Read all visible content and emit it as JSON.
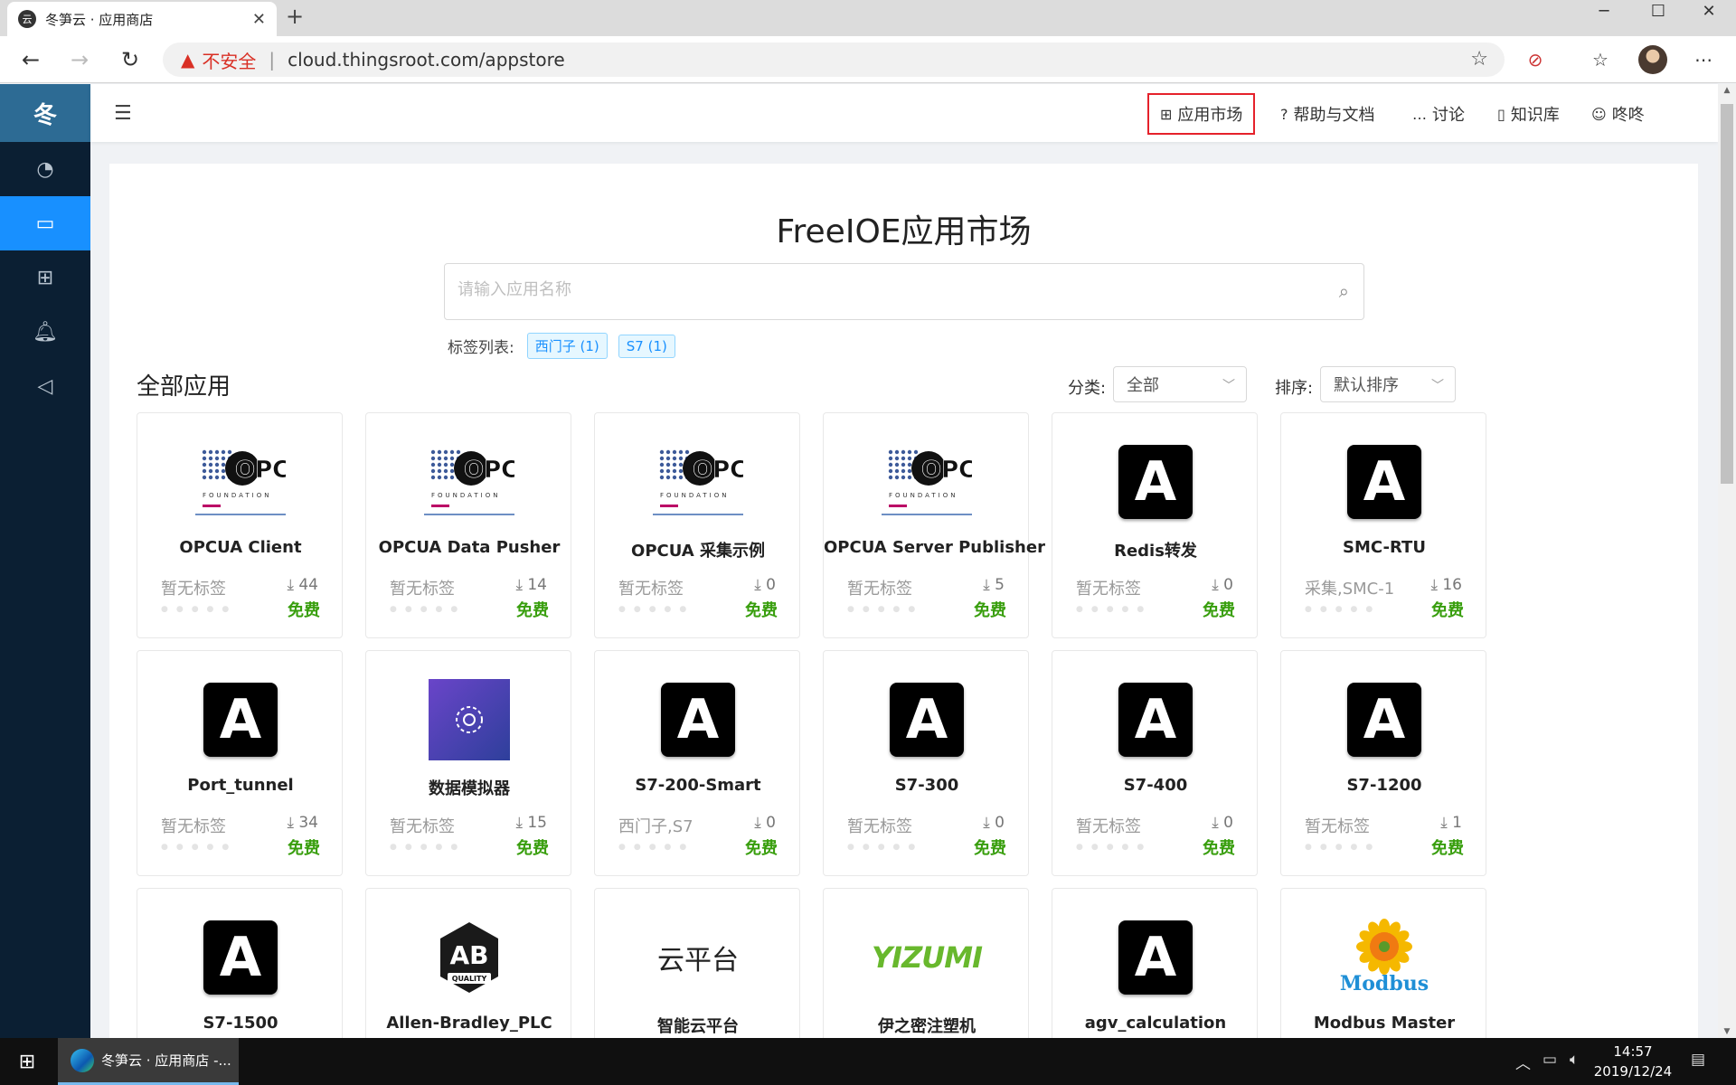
{
  "browser": {
    "tab_title": "冬笋云 · 应用商店",
    "favicon_text": "云",
    "insecure_label": "不安全",
    "url": "cloud.thingsroot.com/appstore",
    "window_controls": [
      "─",
      "☐",
      "✕"
    ]
  },
  "sidebar": {
    "logo": "冬",
    "items": [
      {
        "icon": "dashboard-icon",
        "glyph": "◔"
      },
      {
        "icon": "laptop-icon",
        "glyph": "▭"
      },
      {
        "icon": "apps-grid-icon",
        "glyph": "⊞"
      },
      {
        "icon": "bell-icon",
        "glyph": "🔔︎"
      },
      {
        "icon": "megaphone-icon",
        "glyph": "◁"
      }
    ],
    "active_index": 1
  },
  "header": {
    "nav": [
      {
        "label": "应用市场",
        "icon": "⊞"
      },
      {
        "label": "帮助与文档",
        "icon": "?"
      },
      {
        "label": "讨论",
        "icon": "…"
      },
      {
        "label": "知识库",
        "icon": "▯"
      },
      {
        "label": "咚咚",
        "icon": "☺"
      }
    ]
  },
  "market": {
    "title": "FreeIOE应用市场",
    "search_placeholder": "请输入应用名称",
    "tag_label": "标签列表:",
    "tags": [
      "西门子 (1)",
      "S7 (1)"
    ],
    "section_title": "全部应用",
    "category_label": "分类:",
    "category_value": "全部",
    "sort_label": "排序:",
    "sort_value": "默认排序"
  },
  "apps": [
    {
      "name": "OPCUA Client",
      "logo": "opc",
      "tags": "暂无标签",
      "downloads": "44",
      "price": "免费"
    },
    {
      "name": "OPCUA Data Pusher",
      "logo": "opc",
      "tags": "暂无标签",
      "downloads": "14",
      "price": "免费"
    },
    {
      "name": "OPCUA 采集示例",
      "logo": "opc",
      "tags": "暂无标签",
      "downloads": "0",
      "price": "免费"
    },
    {
      "name": "OPCUA Server Publisher",
      "logo": "opc",
      "tags": "暂无标签",
      "downloads": "5",
      "price": "免费"
    },
    {
      "name": "Redis转发",
      "logo": "A",
      "tags": "暂无标签",
      "downloads": "0",
      "price": "免费"
    },
    {
      "name": "SMC-RTU",
      "logo": "A",
      "tags": "采集,SMC-1",
      "downloads": "16",
      "price": "免费"
    },
    {
      "name": "Port_tunnel",
      "logo": "A",
      "tags": "暂无标签",
      "downloads": "34",
      "price": "免费"
    },
    {
      "name": "数据模拟器",
      "logo": "sim",
      "tags": "暂无标签",
      "downloads": "15",
      "price": "免费"
    },
    {
      "name": "S7-200-Smart",
      "logo": "A",
      "tags": "西门子,S7",
      "downloads": "0",
      "price": "免费"
    },
    {
      "name": "S7-300",
      "logo": "A",
      "tags": "暂无标签",
      "downloads": "0",
      "price": "免费"
    },
    {
      "name": "S7-400",
      "logo": "A",
      "tags": "暂无标签",
      "downloads": "0",
      "price": "免费"
    },
    {
      "name": "S7-1200",
      "logo": "A",
      "tags": "暂无标签",
      "downloads": "1",
      "price": "免费"
    },
    {
      "name": "S7-1500",
      "logo": "A"
    },
    {
      "name": "Allen-Bradley_PLC",
      "logo": "ab",
      "logo_text": "AB",
      "logo_caption": "QUALITY"
    },
    {
      "name": "智能云平台",
      "logo": "cloud",
      "logo_text": "云平台"
    },
    {
      "name": "伊之密注塑机",
      "logo": "yizumi",
      "logo_text": "YIZUMI"
    },
    {
      "name": "agv_calculation",
      "logo": "A"
    },
    {
      "name": "Modbus Master",
      "logo": "modbus",
      "logo_text": "Modbus"
    }
  ],
  "taskbar": {
    "app_label": "冬笋云 · 应用商店 -...",
    "time": "14:57",
    "date": "2019/12/24"
  }
}
